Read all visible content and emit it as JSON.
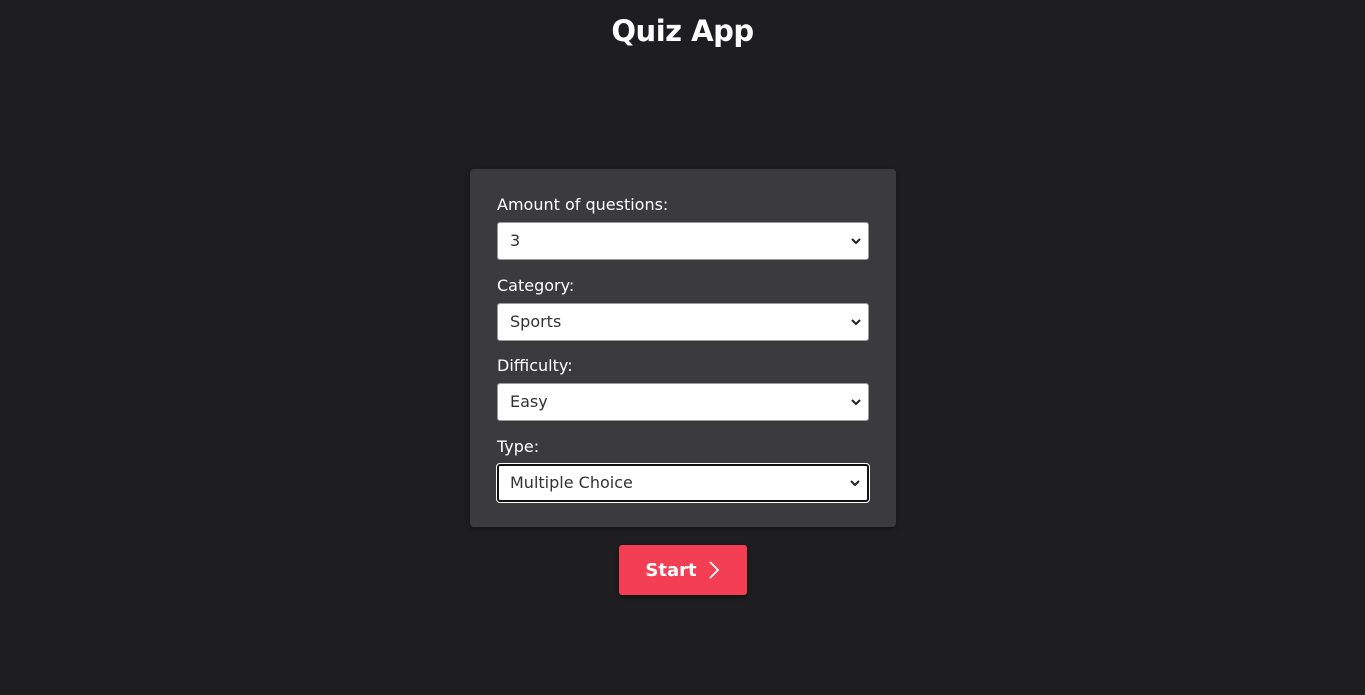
{
  "header": {
    "title": "Quiz App"
  },
  "form": {
    "amount": {
      "label": "Amount of questions:",
      "value": "3"
    },
    "category": {
      "label": "Category:",
      "value": "Sports"
    },
    "difficulty": {
      "label": "Difficulty:",
      "value": "Easy"
    },
    "type": {
      "label": "Type:",
      "value": "Multiple Choice"
    }
  },
  "actions": {
    "start_label": "Start",
    "start_icon": "chevron-right-icon"
  },
  "colors": {
    "background": "#1e1e20",
    "card": "#3b3b3d",
    "accent": "#f43e53",
    "text": "#ffffff"
  }
}
